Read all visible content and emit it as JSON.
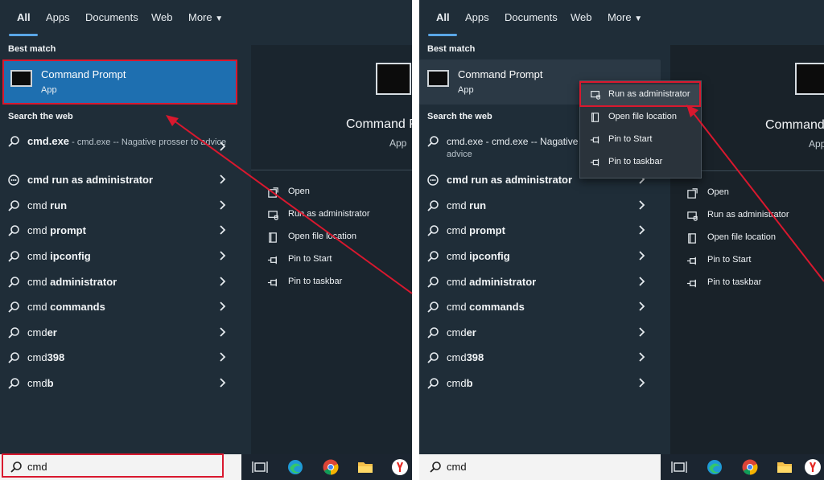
{
  "tabs": [
    "All",
    "Apps",
    "Documents",
    "Web",
    "More"
  ],
  "best_match": {
    "heading": "Best match",
    "title": "Command Prompt",
    "subtitle": "App"
  },
  "search_web_heading": "Search the web",
  "results": [
    {
      "bold": "cmd.exe",
      "rest": " - cmd.exe -- Nagative prosser to advice",
      "icon": "search-icon"
    },
    {
      "bold": "cmd run as administrator",
      "rest": "",
      "icon": "chat-icon"
    },
    {
      "bold": "cmd ",
      "rest": "run",
      "icon": "search-icon"
    },
    {
      "bold": "cmd ",
      "rest": "prompt",
      "icon": "search-icon"
    },
    {
      "bold": "cmd ",
      "rest": "ipconfig",
      "icon": "search-icon"
    },
    {
      "bold": "cmd ",
      "rest": "administrator",
      "icon": "search-icon"
    },
    {
      "bold": "cmd ",
      "rest": "commands",
      "icon": "search-icon"
    },
    {
      "bold": "cmd",
      "rest": "er",
      "icon": "search-icon"
    },
    {
      "bold": "cmd",
      "rest": "398",
      "icon": "search-icon"
    },
    {
      "bold": "cmd",
      "rest": "b",
      "icon": "search-icon"
    }
  ],
  "results_right": {
    "first_line": "cmd.exe - cmd.exe -- Nagative",
    "first_line2": "advice"
  },
  "detail": {
    "title": "Command Prompt",
    "subtitle": "App",
    "actions": [
      "Open",
      "Run as administrator",
      "Open file location",
      "Pin to Start",
      "Pin to taskbar"
    ]
  },
  "context_menu": [
    "Run as administrator",
    "Open file location",
    "Pin to Start",
    "Pin to taskbar"
  ],
  "search": {
    "value": "cmd"
  },
  "taskbar_icons": [
    "task-view-icon",
    "edge-icon",
    "chrome-icon",
    "file-explorer-icon",
    "yandex-icon"
  ],
  "colors": {
    "accent": "#5aa6e6",
    "highlight": "#1e6fb0",
    "annotation_red": "#d9182e"
  }
}
